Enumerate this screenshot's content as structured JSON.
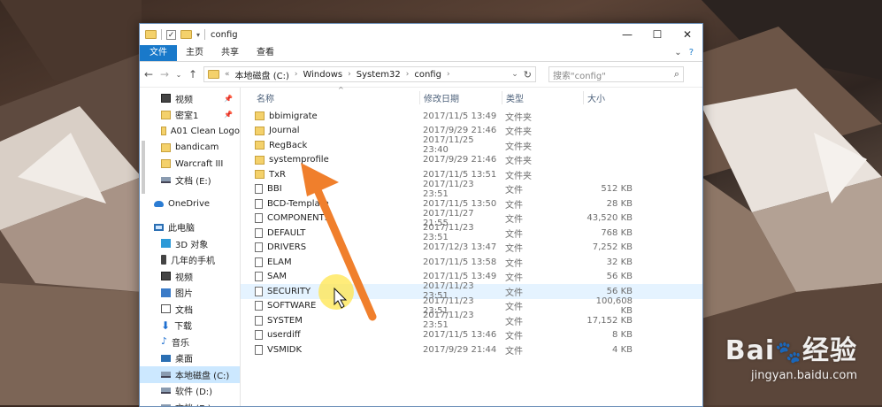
{
  "window": {
    "title": "config",
    "controls": {
      "minimize": "—",
      "maximize": "☐",
      "close": "✕"
    }
  },
  "ribbon": {
    "tabs": [
      "文件",
      "主页",
      "共享",
      "查看"
    ],
    "help": "?"
  },
  "address": {
    "crumbs": [
      "本地磁盘 (C:)",
      "Windows",
      "System32",
      "config"
    ],
    "search_placeholder": "搜索\"config\""
  },
  "nav": {
    "items": [
      {
        "label": "视频",
        "icon": "video-icon",
        "pinned": true,
        "level": 2
      },
      {
        "label": "密室1",
        "icon": "folder-icon",
        "pinned": true,
        "level": 2
      },
      {
        "label": "A01 Clean Logo",
        "icon": "folder-icon",
        "pinned": false,
        "level": 2
      },
      {
        "label": "bandicam",
        "icon": "folder-icon",
        "pinned": false,
        "level": 2
      },
      {
        "label": "Warcraft III",
        "icon": "folder-icon",
        "pinned": false,
        "level": 2
      },
      {
        "label": "文档 (E:)",
        "icon": "drive-icon",
        "pinned": false,
        "level": 2
      },
      {
        "gap": true
      },
      {
        "label": "OneDrive",
        "icon": "onedrive-icon",
        "pinned": false,
        "level": 1
      },
      {
        "gap": true
      },
      {
        "label": "此电脑",
        "icon": "pc-icon",
        "pinned": false,
        "level": 1
      },
      {
        "label": "3D 对象",
        "icon": "3d-objects-icon",
        "pinned": false,
        "level": 2
      },
      {
        "label": "几年的手机",
        "icon": "phone-icon",
        "pinned": false,
        "level": 2
      },
      {
        "label": "视频",
        "icon": "video-icon",
        "pinned": false,
        "level": 2
      },
      {
        "label": "图片",
        "icon": "pictures-icon",
        "pinned": false,
        "level": 2
      },
      {
        "label": "文档",
        "icon": "documents-icon",
        "pinned": false,
        "level": 2
      },
      {
        "label": "下载",
        "icon": "download-icon",
        "pinned": false,
        "level": 2
      },
      {
        "label": "音乐",
        "icon": "music-icon",
        "pinned": false,
        "level": 2
      },
      {
        "label": "桌面",
        "icon": "desktop-icon",
        "pinned": false,
        "level": 2
      },
      {
        "label": "本地磁盘 (C:)",
        "icon": "drive-icon",
        "pinned": false,
        "level": 2,
        "selected": true
      },
      {
        "label": "软件 (D:)",
        "icon": "drive-icon",
        "pinned": false,
        "level": 2
      },
      {
        "label": "文档 (E:)",
        "icon": "drive-icon",
        "pinned": false,
        "level": 2
      }
    ]
  },
  "columns": {
    "name": "名称",
    "date": "修改日期",
    "type": "类型",
    "size": "大小"
  },
  "files": [
    {
      "name": "bbimigrate",
      "date": "2017/11/5 13:49",
      "type": "文件夹",
      "size": "",
      "kind": "folder"
    },
    {
      "name": "Journal",
      "date": "2017/9/29 21:46",
      "type": "文件夹",
      "size": "",
      "kind": "folder"
    },
    {
      "name": "RegBack",
      "date": "2017/11/25 23:40",
      "type": "文件夹",
      "size": "",
      "kind": "folder"
    },
    {
      "name": "systemprofile",
      "date": "2017/9/29 21:46",
      "type": "文件夹",
      "size": "",
      "kind": "folder"
    },
    {
      "name": "TxR",
      "date": "2017/11/5 13:51",
      "type": "文件夹",
      "size": "",
      "kind": "folder"
    },
    {
      "name": "BBI",
      "date": "2017/11/23 23:51",
      "type": "文件",
      "size": "512 KB",
      "kind": "file"
    },
    {
      "name": "BCD-Template",
      "date": "2017/11/5 13:50",
      "type": "文件",
      "size": "28 KB",
      "kind": "file"
    },
    {
      "name": "COMPONENTS",
      "date": "2017/11/27 21:55",
      "type": "文件",
      "size": "43,520 KB",
      "kind": "file"
    },
    {
      "name": "DEFAULT",
      "date": "2017/11/23 23:51",
      "type": "文件",
      "size": "768 KB",
      "kind": "file"
    },
    {
      "name": "DRIVERS",
      "date": "2017/12/3 13:47",
      "type": "文件",
      "size": "7,252 KB",
      "kind": "file"
    },
    {
      "name": "ELAM",
      "date": "2017/11/5 13:58",
      "type": "文件",
      "size": "32 KB",
      "kind": "file"
    },
    {
      "name": "SAM",
      "date": "2017/11/5 13:49",
      "type": "文件",
      "size": "56 KB",
      "kind": "file"
    },
    {
      "name": "SECURITY",
      "date": "2017/11/23 23:51",
      "type": "文件",
      "size": "56 KB",
      "kind": "file",
      "selected": true
    },
    {
      "name": "SOFTWARE",
      "date": "2017/11/23 23:51",
      "type": "文件",
      "size": "100,608 KB",
      "kind": "file"
    },
    {
      "name": "SYSTEM",
      "date": "2017/11/23 23:51",
      "type": "文件",
      "size": "17,152 KB",
      "kind": "file"
    },
    {
      "name": "userdiff",
      "date": "2017/11/5 13:46",
      "type": "文件",
      "size": "8 KB",
      "kind": "file"
    },
    {
      "name": "VSMIDK",
      "date": "2017/9/29 21:44",
      "type": "文件",
      "size": "4 KB",
      "kind": "file"
    }
  ],
  "watermark": {
    "brand": "Bai",
    "brand_suffix": "经验",
    "url": "jingyan.baidu.com"
  },
  "colors": {
    "accent": "#1979ca",
    "annotation_arrow": "#f07f2c",
    "cursor_highlight": "#ffe54d"
  }
}
